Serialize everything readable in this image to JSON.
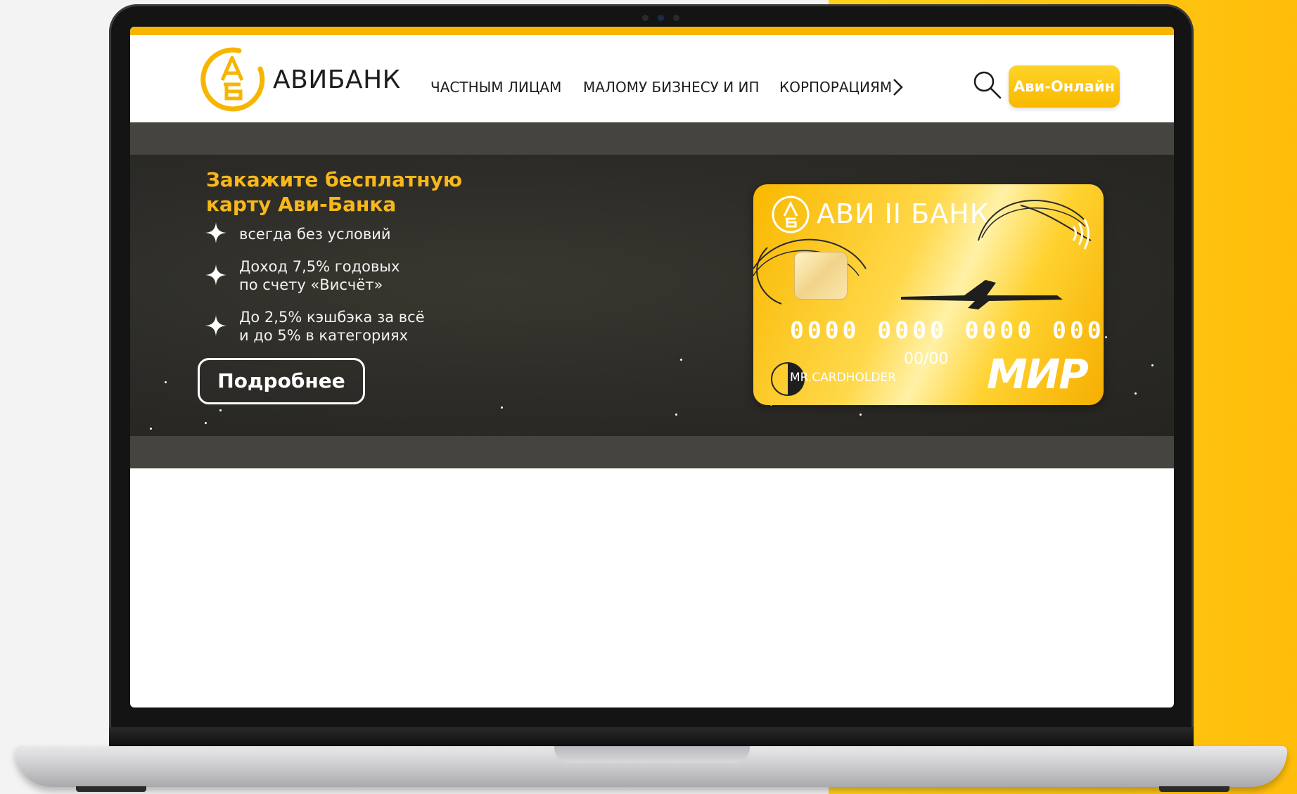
{
  "brand": {
    "name": "АВИБАНК",
    "logo_icon": "avibank-logo-icon",
    "accent_color": "#f7b500"
  },
  "nav": {
    "items": [
      {
        "label": "ЧАСТНЫМ ЛИЦАМ"
      },
      {
        "label": "МАЛОМУ БИЗНЕСУ И ИП"
      },
      {
        "label": "КОРПОРАЦИЯМ"
      }
    ],
    "more_icon": "chevron-right-icon"
  },
  "header": {
    "search_icon": "search-icon",
    "online_button": "Ави-Онлайн"
  },
  "hero": {
    "title": "Закажите бесплатную карту Ави-Банка",
    "features": [
      {
        "line1": "всегда без условий",
        "line2": ""
      },
      {
        "line1": "Доход 7,5% годовых",
        "line2": "по счету «Висчёт»"
      },
      {
        "line1": "До 2,5% кэшбэка за всё",
        "line2": "и до 5% в категориях"
      }
    ],
    "feature_icon": "sparkle-star-icon",
    "more_button": "Подробнее"
  },
  "card": {
    "brand": "АВИ II БАНК",
    "number": "0000 0000 0000 0000",
    "expiry": "00/00",
    "holder": "MR.CARDHOLDER",
    "payment_system": "МИР",
    "color": "#f9b800"
  }
}
